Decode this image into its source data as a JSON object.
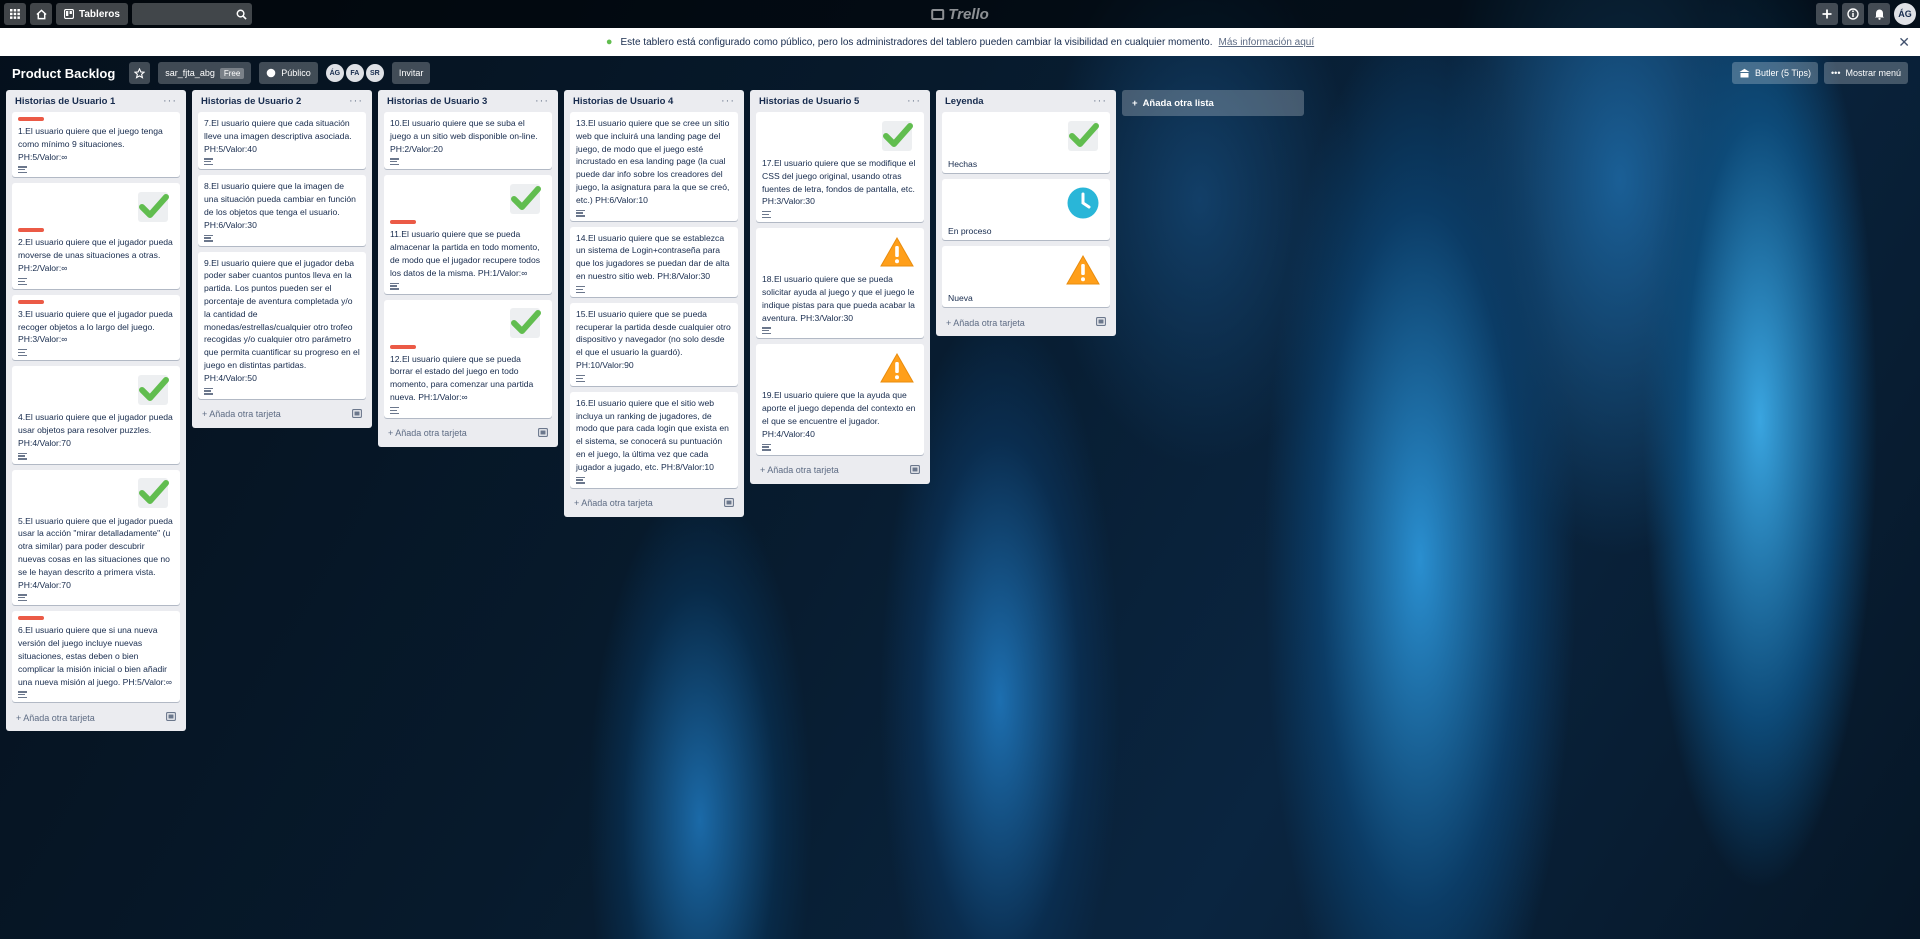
{
  "topbar": {
    "boards_label": "Tableros",
    "logo_text": "Trello",
    "avatar": "ÁG"
  },
  "banner": {
    "message": "Este tablero está configurado como público, pero los administradores del tablero pueden cambiar la visibilidad en cualquier momento.",
    "link": "Más información aquí"
  },
  "board": {
    "title": "Product Backlog",
    "team": "sar_fjta_abg",
    "team_badge": "Free",
    "visibility": "Público",
    "members": [
      "ÁG",
      "FA",
      "SR"
    ],
    "invite": "Invitar",
    "butler": "Butler (5 Tips)",
    "menu": "Mostrar menú"
  },
  "add_card_label": "Añada otra tarjeta",
  "add_list_label": "Añada otra lista",
  "lists": [
    {
      "title": "Historias de Usuario 1",
      "cards": [
        {
          "label": "red",
          "icon": "",
          "text": "1.El usuario quiere que el juego tenga como mínimo 9 situaciones. PH:5/Valor:∞"
        },
        {
          "label": "red",
          "icon": "check",
          "text": "2.El usuario quiere que el jugador pueda moverse de unas situaciones a otras. PH:2/Valor:∞"
        },
        {
          "label": "red",
          "icon": "",
          "text": "3.El usuario quiere que el jugador pueda recoger objetos a lo largo del juego. PH:3/Valor:∞"
        },
        {
          "label": "",
          "icon": "check",
          "text": "4.El usuario quiere que el jugador pueda usar objetos para resolver puzzles. PH:4/Valor:70"
        },
        {
          "label": "",
          "icon": "check",
          "text": "5.El usuario quiere que el jugador pueda usar la acción \"mirar detalladamente\" (u otra similar) para poder descubrir nuevas cosas en las situaciones que no se le hayan descrito a primera vista. PH:4/Valor:70"
        },
        {
          "label": "red",
          "icon": "",
          "text": "6.El usuario quiere que si una nueva versión del juego incluye nuevas situaciones, estas deben o bien complicar la misión inicial o bien añadir una nueva misión al juego. PH:5/Valor:∞"
        }
      ]
    },
    {
      "title": "Historias de Usuario 2",
      "cards": [
        {
          "label": "",
          "icon": "",
          "text": "7.El usuario quiere que cada situación lleve una imagen descriptiva asociada. PH:5/Valor:40"
        },
        {
          "label": "",
          "icon": "",
          "text": "8.El usuario quiere que la imagen de una situación pueda cambiar en función de los objetos que tenga el usuario. PH:6/Valor:30"
        },
        {
          "label": "",
          "icon": "",
          "text": "9.El usuario quiere que el jugador deba poder saber cuantos puntos lleva en la partida. Los puntos pueden ser el porcentaje de aventura completada y/o la cantidad de monedas/estrellas/cualquier otro trofeo recogidas y/o cualquier otro parámetro que permita cuantificar su progreso en el juego en distintas partidas. PH:4/Valor:50"
        }
      ]
    },
    {
      "title": "Historias de Usuario 3",
      "cards": [
        {
          "label": "",
          "icon": "",
          "text": "10.El usuario quiere que se suba el juego a un sitio web disponible on-line. PH:2/Valor:20"
        },
        {
          "label": "red",
          "icon": "check",
          "text": "11.El usuario quiere que se pueda almacenar la partida en todo momento, de modo que el jugador recupere todos los datos de la misma. PH:1/Valor:∞"
        },
        {
          "label": "red",
          "icon": "check",
          "text": "12.El usuario quiere que se pueda borrar el estado del juego en todo momento, para comenzar una partida nueva. PH:1/Valor:∞"
        }
      ]
    },
    {
      "title": "Historias de Usuario 4",
      "cards": [
        {
          "label": "",
          "icon": "",
          "text": "13.El usuario quiere que se cree un sitio web que incluirá una landing page del juego, de modo que el juego esté incrustado en esa landing page (la cual puede dar info sobre los creadores del juego, la asignatura para la que se creó, etc.) PH:6/Valor:10"
        },
        {
          "label": "",
          "icon": "",
          "text": "14.El usuario quiere que se establezca un sistema de Login+contraseña para que los jugadores se puedan dar de alta en nuestro sitio web. PH:8/Valor:30"
        },
        {
          "label": "",
          "icon": "",
          "text": "15.El usuario quiere que se pueda recuperar la partida desde cualquier otro dispositivo y navegador (no solo desde el que el usuario la guardó). PH:10/Valor:90"
        },
        {
          "label": "",
          "icon": "",
          "text": "16.El usuario quiere que el sitio web incluya un ranking de jugadores, de modo que para cada login que exista en el sistema, se conocerá su puntuación en el juego, la última vez que cada jugador a jugado, etc. PH:8/Valor:10"
        }
      ]
    },
    {
      "title": "Historias de Usuario 5",
      "cards": [
        {
          "label": "",
          "icon": "check",
          "text": "17.El usuario quiere que se modifique el CSS del juego original, usando otras fuentes de letra, fondos de pantalla, etc. PH:3/Valor:30"
        },
        {
          "label": "",
          "icon": "warning",
          "text": "18.El usuario quiere que se pueda solicitar ayuda al juego y que el juego le indique pistas para que pueda acabar la aventura. PH:3/Valor:30"
        },
        {
          "label": "",
          "icon": "warning",
          "text": "19.El usuario quiere que la ayuda que aporte el juego dependa del contexto en el que se encuentre el jugador. PH:4/Valor:40"
        }
      ]
    },
    {
      "title": "Leyenda",
      "cards": [
        {
          "label": "",
          "icon": "check",
          "text": "Hechas"
        },
        {
          "label": "",
          "icon": "clock",
          "text": "En proceso"
        },
        {
          "label": "",
          "icon": "warning",
          "text": "Nueva"
        }
      ]
    }
  ],
  "colors": {
    "label_red": "#eb5a46",
    "check_green": "#61bd4f",
    "warning_orange": "#ff9f1a",
    "clock_blue": "#29b6d8"
  }
}
